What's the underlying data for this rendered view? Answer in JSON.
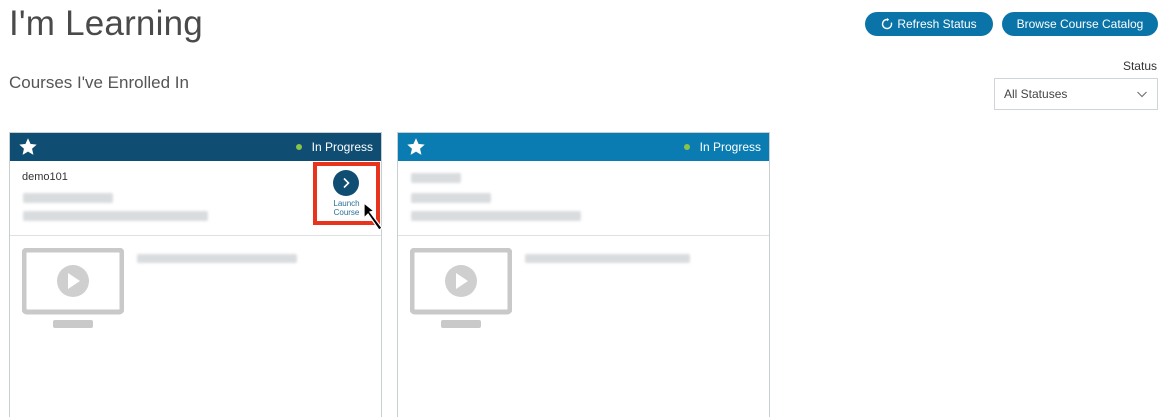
{
  "header": {
    "title": "I'm Learning",
    "refresh_label": "Refresh Status",
    "browse_label": "Browse Course Catalog"
  },
  "section": {
    "subtitle": "Courses I've Enrolled In"
  },
  "filter": {
    "label": "Status",
    "selected": "All Statuses"
  },
  "courses": [
    {
      "code": "demo101",
      "status": "In Progress",
      "launch_label_line1": "Launch",
      "launch_label_line2": "Course"
    },
    {
      "code": "",
      "status": "In Progress"
    }
  ],
  "colors": {
    "accent": "#0a74a8",
    "card1_header": "#0f4d73",
    "card2_header": "#0a7cb2",
    "status_dot": "#8ac34a",
    "highlight": "#e8341c"
  },
  "icons": [
    "refresh-icon",
    "chevron-down-icon",
    "star-icon",
    "chevron-right-icon",
    "play-icon",
    "cursor-arrow-icon"
  ]
}
